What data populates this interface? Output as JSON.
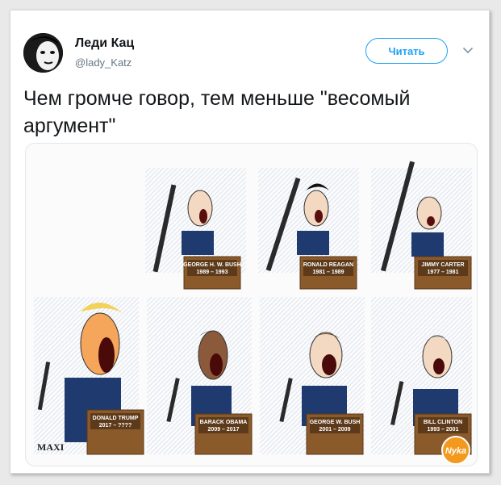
{
  "tweet": {
    "author_name": "Леди Кац",
    "author_handle": "@lady_Katz",
    "follow_label": "Читать",
    "text": "Чем громче говор, тем меньше \"весомый аргумент\""
  },
  "media": {
    "panels": [
      {
        "plaque": [
          "GEORGE H. W. BUSH",
          "1989 – 1993"
        ]
      },
      {
        "plaque": [
          "RONALD REAGAN",
          "1981 – 1989"
        ]
      },
      {
        "plaque": [
          "JIMMY CARTER",
          "1977 – 1981"
        ]
      },
      {
        "plaque": [
          "DONALD TRUMP",
          "2017 – ????"
        ]
      },
      {
        "plaque": [
          "BARACK OBAMA",
          "2009 – 2017"
        ]
      },
      {
        "plaque": [
          "GEORGE W. BUSH",
          "2001 – 2009"
        ]
      },
      {
        "plaque": [
          "BILL CLINTON",
          "1993 – 2001"
        ]
      }
    ],
    "signature": "MAXI",
    "logo_text": "Nyka"
  },
  "colors": {
    "accent": "#1da1f2",
    "text": "#14171a",
    "muted": "#657786",
    "podium": "#8b5a2b",
    "suit": "#1f3a6e"
  },
  "icons": {
    "chevron": "chevron-down-icon"
  }
}
